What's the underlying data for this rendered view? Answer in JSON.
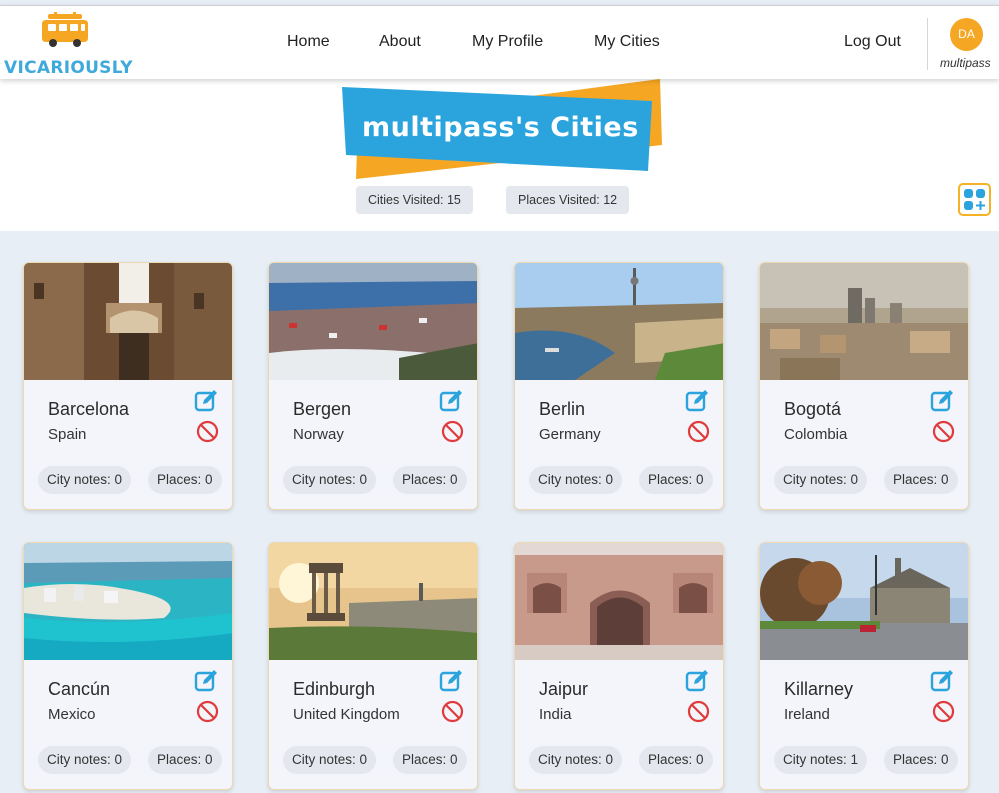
{
  "brand": {
    "logo_text": "VICARIOUSLY"
  },
  "nav": {
    "home": "Home",
    "about": "About",
    "profile": "My Profile",
    "cities": "My Cities",
    "logout": "Log Out"
  },
  "user": {
    "initials": "DA",
    "username": "multipass"
  },
  "header": {
    "title": "multipass's Cities",
    "cities_visited": "Cities Visited: 15",
    "places_visited": "Places Visited: 12"
  },
  "colors": {
    "accent_blue": "#2ba3dd",
    "accent_orange": "#f5a623",
    "delete_red": "#e03a3a"
  },
  "cities": [
    {
      "name": "Barcelona",
      "country": "Spain",
      "notes": "City notes: 0",
      "places": "Places: 0"
    },
    {
      "name": "Bergen",
      "country": "Norway",
      "notes": "City notes: 0",
      "places": "Places: 0"
    },
    {
      "name": "Berlin",
      "country": "Germany",
      "notes": "City notes: 0",
      "places": "Places: 0"
    },
    {
      "name": "Bogotá",
      "country": "Colombia",
      "notes": "City notes: 0",
      "places": "Places: 0"
    },
    {
      "name": "Cancún",
      "country": "Mexico",
      "notes": "City notes: 0",
      "places": "Places: 0"
    },
    {
      "name": "Edinburgh",
      "country": "United Kingdom",
      "notes": "City notes: 0",
      "places": "Places: 0"
    },
    {
      "name": "Jaipur",
      "country": "India",
      "notes": "City notes: 0",
      "places": "Places: 0"
    },
    {
      "name": "Killarney",
      "country": "Ireland",
      "notes": "City notes: 1",
      "places": "Places: 0"
    }
  ]
}
